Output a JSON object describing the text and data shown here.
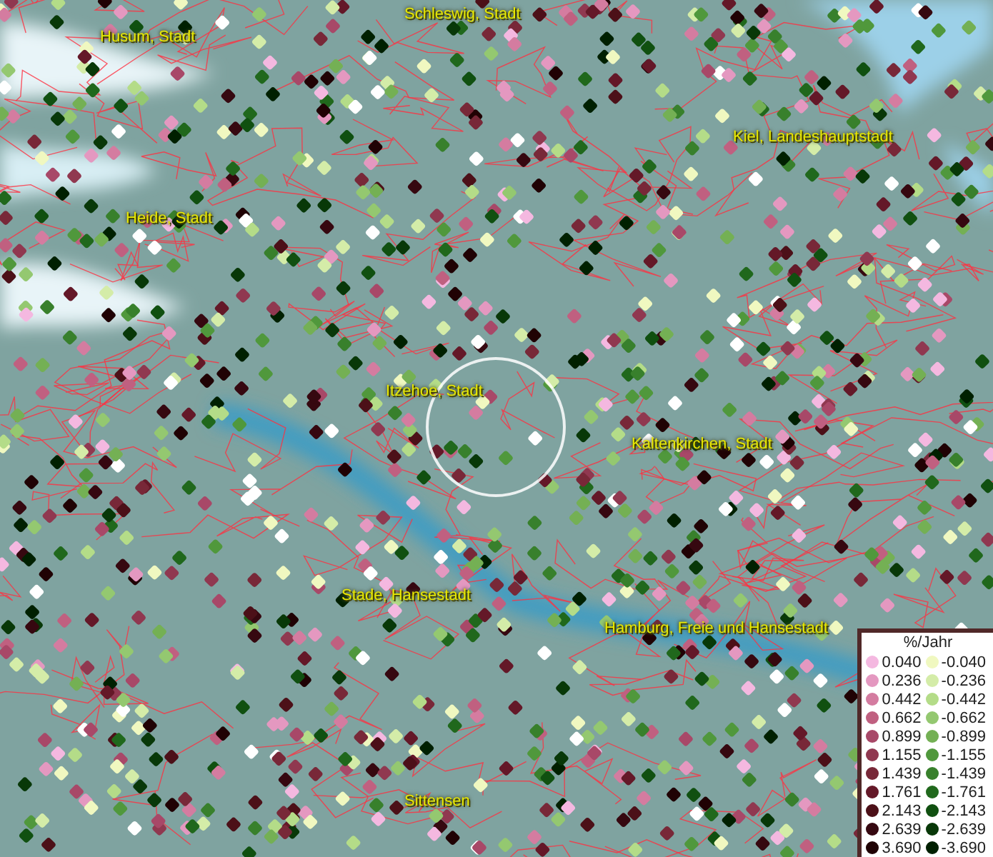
{
  "map": {
    "places": [
      {
        "name": "Schleswig, Stadt"
      },
      {
        "name": "Husum, Stadt"
      },
      {
        "name": "Kiel, Landeshauptstadt"
      },
      {
        "name": "Heide, Stadt"
      },
      {
        "name": "Itzehoe, Stadt"
      },
      {
        "name": "Kaltenkirchen, Stadt"
      },
      {
        "name": "Stade, Hansestadt"
      },
      {
        "name": "Hamburg, Freie und Hansestadt"
      },
      {
        "name": "Sittensen"
      }
    ]
  },
  "legend": {
    "title": "%/Jahr",
    "rows": [
      {
        "positive": {
          "label": "0.040",
          "color": "#f4b8e0"
        },
        "negative": {
          "label": "-0.040",
          "color": "#f0f8c0"
        }
      },
      {
        "positive": {
          "label": "0.236",
          "color": "#e498c0"
        },
        "negative": {
          "label": "-0.236",
          "color": "#d4eca8"
        }
      },
      {
        "positive": {
          "label": "0.442",
          "color": "#d47ca0"
        },
        "negative": {
          "label": "-0.442",
          "color": "#b4dc88"
        }
      },
      {
        "positive": {
          "label": "0.662",
          "color": "#c06080"
        },
        "negative": {
          "label": "-0.662",
          "color": "#94c870"
        }
      },
      {
        "positive": {
          "label": "0.899",
          "color": "#a84868"
        },
        "negative": {
          "label": "-0.899",
          "color": "#74b054"
        }
      },
      {
        "positive": {
          "label": "1.155",
          "color": "#903850"
        },
        "negative": {
          "label": "-1.155",
          "color": "#50983c"
        }
      },
      {
        "positive": {
          "label": "1.439",
          "color": "#782838"
        },
        "negative": {
          "label": "-1.439",
          "color": "#38802c"
        }
      },
      {
        "positive": {
          "label": "1.761",
          "color": "#641828"
        },
        "negative": {
          "label": "-1.761",
          "color": "#20681c"
        }
      },
      {
        "positive": {
          "label": "2.143",
          "color": "#4c1018"
        },
        "negative": {
          "label": "-2.143",
          "color": "#105010"
        }
      },
      {
        "positive": {
          "label": "2.639",
          "color": "#360810"
        },
        "negative": {
          "label": "-2.639",
          "color": "#083808"
        }
      },
      {
        "positive": {
          "label": "3.690",
          "color": "#200204"
        },
        "negative": {
          "label": "-3.690",
          "color": "#002000"
        }
      }
    ]
  }
}
